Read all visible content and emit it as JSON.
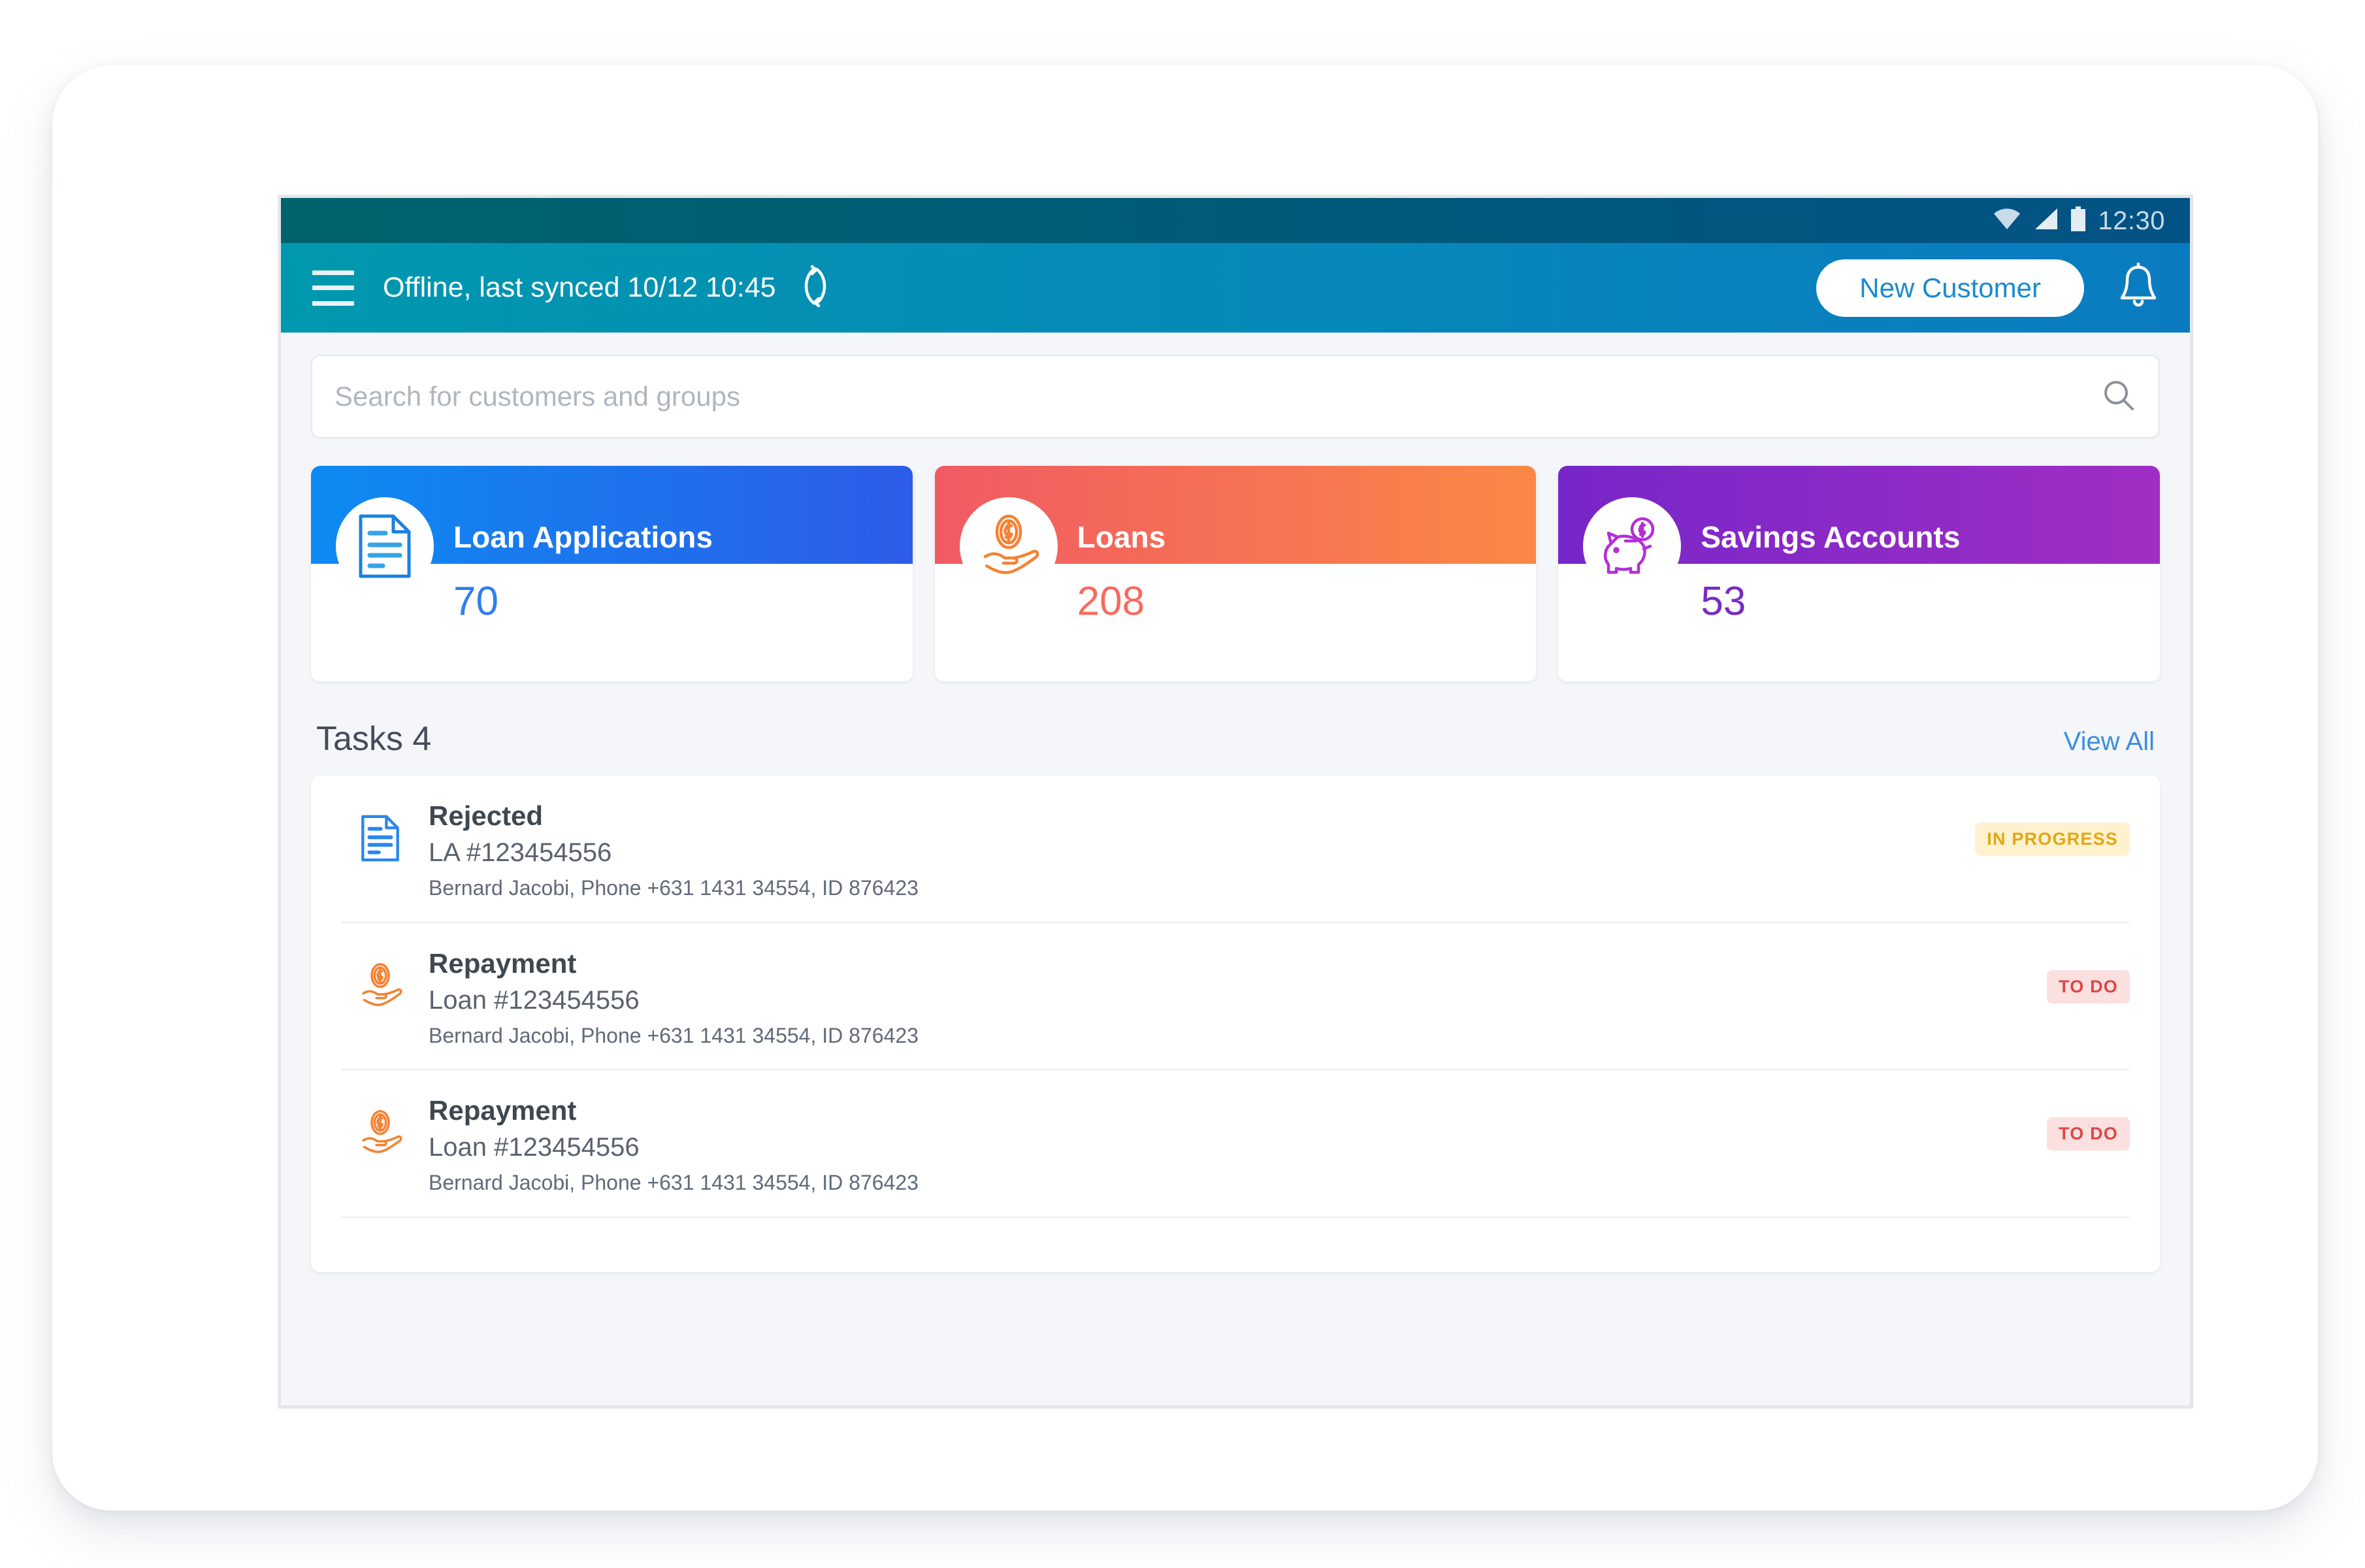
{
  "status_bar": {
    "time": "12:30",
    "icons": [
      "wifi-icon",
      "cellular-signal-icon",
      "battery-icon"
    ]
  },
  "app_bar": {
    "menu_icon": "hamburger-menu-icon",
    "sync_status": "Offline, last synced 10/12 10:45",
    "refresh_icon": "sync-refresh-icon",
    "new_customer_label": "New Customer",
    "bell_icon": "notification-bell-icon"
  },
  "search": {
    "placeholder": "Search for customers and groups",
    "value": "",
    "icon": "search-icon"
  },
  "stat_cards": [
    {
      "label": "Loan Applications",
      "value": "70",
      "icon": "document-icon",
      "band_from": "#0d8bf2",
      "band_to": "#2d5ce8",
      "accent": "#2f7ef0"
    },
    {
      "label": "Loans",
      "value": "208",
      "icon": "hand-holding-coin-icon",
      "band_from": "#f15a63",
      "band_to": "#fa8846",
      "accent": "#f96a5e"
    },
    {
      "label": "Savings Accounts",
      "value": "53",
      "icon": "piggy-bank-icon",
      "band_from": "#7726c9",
      "band_to": "#a02ec4",
      "accent": "#7a2bc4"
    }
  ],
  "tasks": {
    "title": "Tasks 4",
    "view_all_label": "View All",
    "rows": [
      {
        "title": "Rejected",
        "reference": "LA #123454556",
        "meta": "Bernard Jacobi, Phone +631 1431 34554, ID 876423",
        "status": "IN PROGRESS",
        "status_kind": "in-progress",
        "icon": "document-icon"
      },
      {
        "title": "Repayment",
        "reference": "Loan #123454556",
        "meta": "Bernard Jacobi, Phone +631 1431 34554, ID 876423",
        "status": "TO DO",
        "status_kind": "to-do",
        "icon": "hand-holding-coin-icon"
      },
      {
        "title": "Repayment",
        "reference": "Loan #123454556",
        "meta": "Bernard Jacobi, Phone +631 1431 34554, ID 876423",
        "status": "TO DO",
        "status_kind": "to-do",
        "icon": "hand-holding-coin-icon"
      }
    ]
  },
  "colors": {
    "status_bar_from": "#00636c",
    "status_bar_to": "#035285",
    "app_bar_from": "#0098ae",
    "app_bar_to": "#0b7bc1",
    "screen_background": "#f4f6f9",
    "link": "#3d8ddd"
  }
}
